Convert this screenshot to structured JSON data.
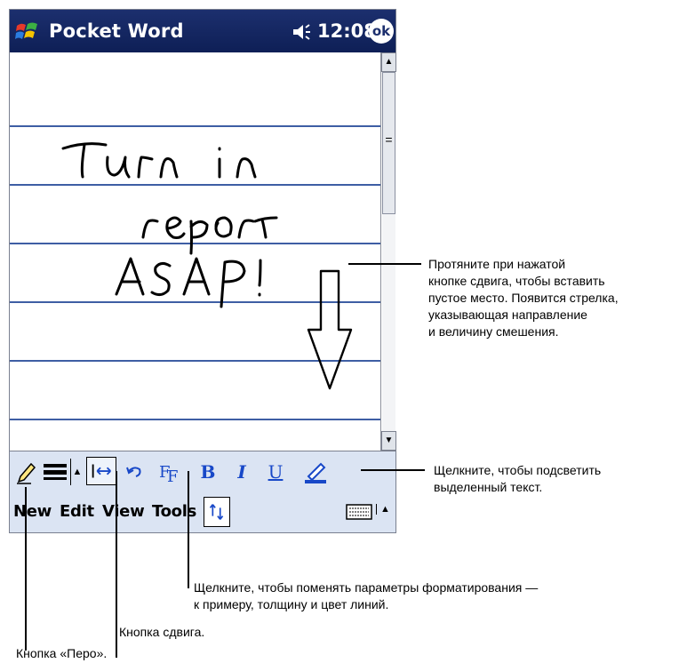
{
  "titlebar": {
    "app_title": "Pocket Word",
    "time": "12:08",
    "ok_label": "ok"
  },
  "document": {
    "handwriting": [
      "Turn in",
      "report",
      "ASAP!"
    ]
  },
  "toolbar": {
    "bold_label": "B",
    "italic_label": "I",
    "underline_label": "U"
  },
  "menubar": {
    "items": [
      "New",
      "Edit",
      "View",
      "Tools"
    ]
  },
  "callouts": {
    "space_lines": [
      "Протяните при нажатой",
      "кнопке сдвига, чтобы вставить",
      "пустое место. Появится стрелка,",
      "указывающая направление",
      "и величину смешения."
    ],
    "highlight_lines": [
      "Щелкните, чтобы подсветить",
      "выделенный текст."
    ],
    "format_lines": [
      "Щелкните, чтобы поменять параметры форматирования —",
      "к примеру, толщину и цвет линий."
    ],
    "space_button": "Кнопка сдвига.",
    "pen_button": "Кнопка «Перо»."
  }
}
